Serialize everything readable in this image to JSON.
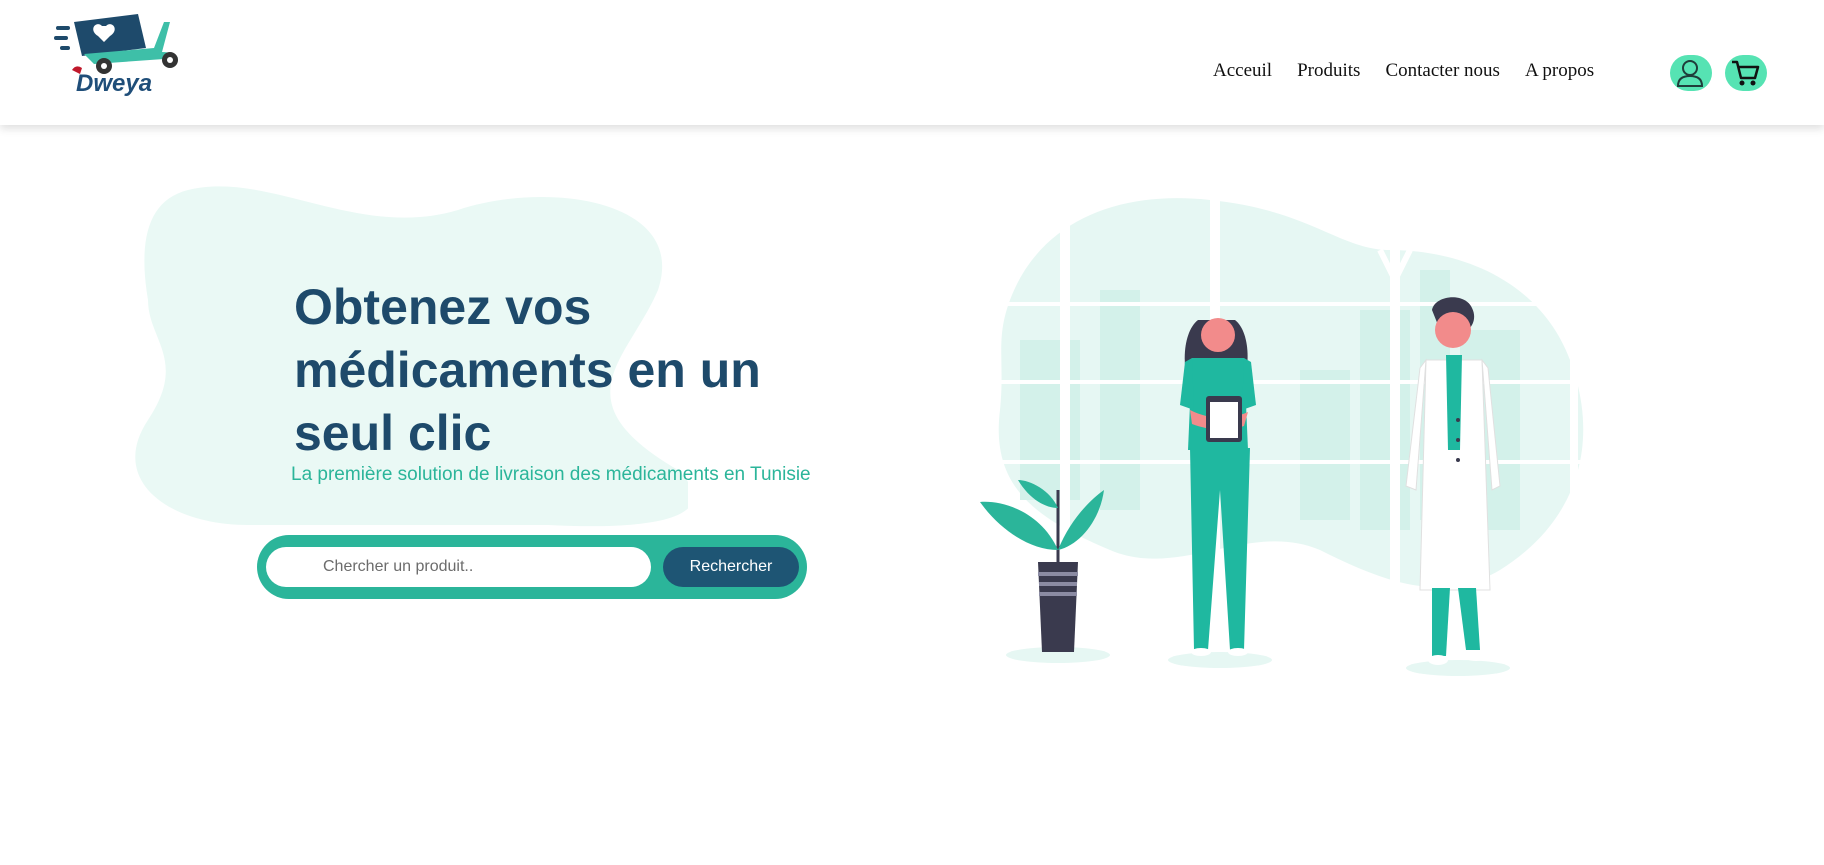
{
  "brand": {
    "name": "Dweya"
  },
  "nav": {
    "items": [
      "Acceuil",
      "Produits",
      "Contacter nous",
      "A propos"
    ]
  },
  "header_icons": [
    "user-icon",
    "cart-icon"
  ],
  "hero": {
    "title": "Obtenez vos médicaments en un seul clic",
    "subtitle": "La première solution de livraison des médicaments en Tunisie"
  },
  "search": {
    "placeholder": "Chercher un produit..",
    "button_label": "Rechercher"
  },
  "colors": {
    "accent": "#2bb59a",
    "mint": "#56e3b3",
    "navy": "#1e4a6b",
    "button": "#1e5574",
    "blob": "#eaf9f5"
  }
}
